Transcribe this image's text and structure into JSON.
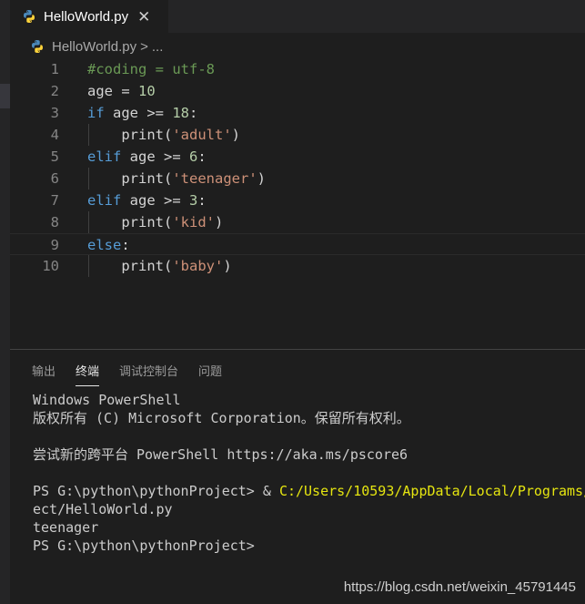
{
  "tab": {
    "label": "HelloWorld.py",
    "close_glyph": "✕",
    "icon": "python-icon"
  },
  "breadcrumb": {
    "file": "HelloWorld.py",
    "separator": ">",
    "more": "..."
  },
  "editor": {
    "lines": [
      {
        "number": "1",
        "tokens": [
          {
            "t": "#coding = utf-8",
            "k": "comment"
          }
        ]
      },
      {
        "number": "2",
        "tokens": [
          {
            "t": "age = ",
            "k": "plain"
          },
          {
            "t": "10",
            "k": "number"
          }
        ]
      },
      {
        "number": "3",
        "tokens": [
          {
            "t": "if",
            "k": "keyword"
          },
          {
            "t": " age >= ",
            "k": "plain"
          },
          {
            "t": "18",
            "k": "number"
          },
          {
            "t": ":",
            "k": "plain"
          }
        ]
      },
      {
        "number": "4",
        "tokens": [
          {
            "t": "    print(",
            "k": "plain"
          },
          {
            "t": "'adult'",
            "k": "string"
          },
          {
            "t": ")",
            "k": "plain"
          }
        ]
      },
      {
        "number": "5",
        "tokens": [
          {
            "t": "elif",
            "k": "keyword"
          },
          {
            "t": " age >= ",
            "k": "plain"
          },
          {
            "t": "6",
            "k": "number"
          },
          {
            "t": ":",
            "k": "plain"
          }
        ]
      },
      {
        "number": "6",
        "tokens": [
          {
            "t": "    print(",
            "k": "plain"
          },
          {
            "t": "'teenager'",
            "k": "string"
          },
          {
            "t": ")",
            "k": "plain"
          }
        ]
      },
      {
        "number": "7",
        "tokens": [
          {
            "t": "elif",
            "k": "keyword"
          },
          {
            "t": " age >= ",
            "k": "plain"
          },
          {
            "t": "3",
            "k": "number"
          },
          {
            "t": ":",
            "k": "plain"
          }
        ]
      },
      {
        "number": "8",
        "tokens": [
          {
            "t": "    print(",
            "k": "plain"
          },
          {
            "t": "'kid'",
            "k": "string"
          },
          {
            "t": ")",
            "k": "plain"
          }
        ]
      },
      {
        "number": "9",
        "tokens": [
          {
            "t": "else",
            "k": "keyword"
          },
          {
            "t": ":",
            "k": "plain"
          }
        ],
        "current": true
      },
      {
        "number": "10",
        "tokens": [
          {
            "t": "    print(",
            "k": "plain"
          },
          {
            "t": "'baby'",
            "k": "string"
          },
          {
            "t": ")",
            "k": "plain"
          }
        ]
      }
    ]
  },
  "panel": {
    "tabs": [
      {
        "label": "输出",
        "active": false
      },
      {
        "label": "终端",
        "active": true
      },
      {
        "label": "调试控制台",
        "active": false
      },
      {
        "label": "问题",
        "active": false
      }
    ]
  },
  "terminal": {
    "line1": "Windows PowerShell",
    "line2": "版权所有 (C) Microsoft Corporation。保留所有权利。",
    "line3": "尝试新的跨平台 PowerShell https://aka.ms/pscore6",
    "prompt1": "PS G:\\python\\pythonProject> & ",
    "cmd_path": "C:/Users/10593/AppData/Local/Programs/",
    "line5": "ect/HelloWorld.py",
    "line6": "teenager",
    "prompt2": "PS G:\\python\\pythonProject>"
  },
  "watermark": "https://blog.csdn.net/weixin_45791445",
  "colors": {
    "background": "#1e1e1e",
    "keyword": "#569cd6",
    "string": "#ce9178",
    "number": "#b5cea8",
    "comment": "#6a9955",
    "terminal_path": "#e5e510"
  }
}
